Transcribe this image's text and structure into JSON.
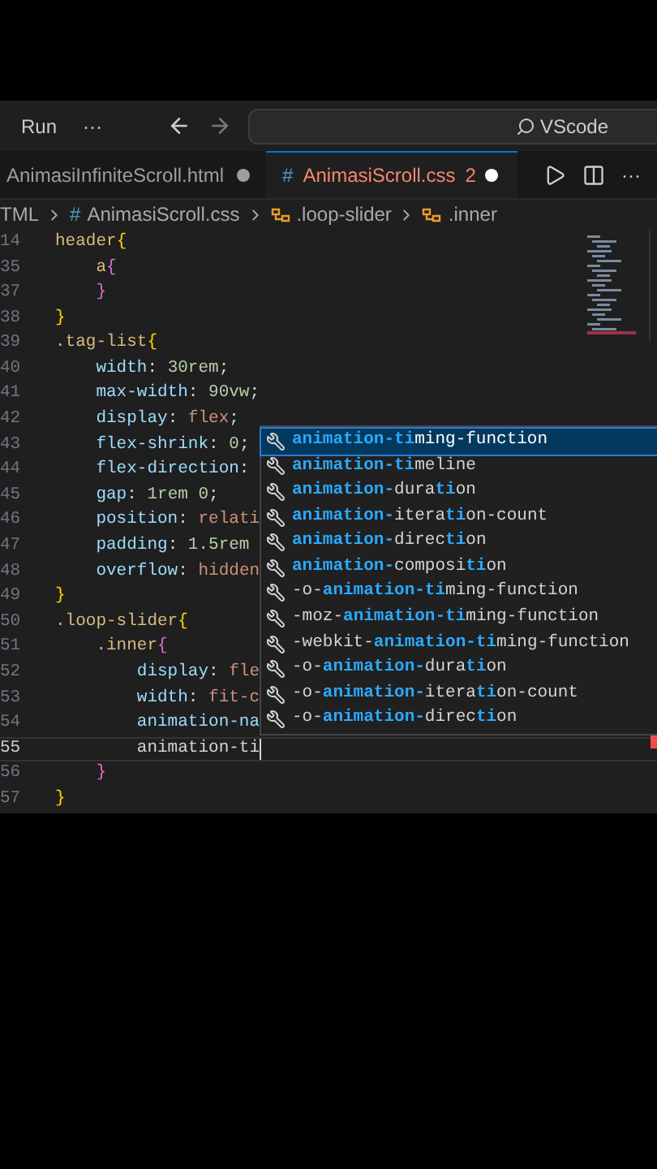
{
  "titlebar": {
    "run": "Run",
    "more": "···",
    "search": "VScode"
  },
  "tabs": [
    {
      "label": "AnimasiInfiniteScroll.html",
      "selected": false
    },
    {
      "label": "AnimasiScroll.css",
      "selected": true,
      "icon": "#",
      "problems": "2"
    }
  ],
  "editor_actions": {
    "more": "···"
  },
  "breadcrumb": [
    {
      "label": "TML",
      "kind": "text"
    },
    {
      "label": "AnimasiScroll.css",
      "kind": "css",
      "icon": "#"
    },
    {
      "label": ".loop-slider",
      "kind": "selector"
    },
    {
      "label": ".inner",
      "kind": "selector"
    }
  ],
  "lines": [
    {
      "number": "14",
      "current": false,
      "tokens": [
        {
          "kind": "selector",
          "text": "header"
        },
        {
          "kind": "brace1",
          "text": "{"
        }
      ]
    },
    {
      "number": "35",
      "current": false,
      "tokens": [
        {
          "kind": "selector",
          "text": "    a"
        },
        {
          "kind": "brace2",
          "text": "{"
        }
      ]
    },
    {
      "number": "37",
      "current": false,
      "tokens": [
        {
          "kind": "brace2",
          "text": "    }"
        }
      ]
    },
    {
      "number": "38",
      "current": false,
      "tokens": [
        {
          "kind": "brace1",
          "text": "}"
        }
      ]
    },
    {
      "number": "39",
      "current": false,
      "tokens": [
        {
          "kind": "selector",
          "text": ".tag-list"
        },
        {
          "kind": "brace1",
          "text": "{"
        }
      ]
    },
    {
      "number": "40",
      "current": false,
      "tokens": [
        {
          "kind": "property",
          "text": "    width"
        },
        {
          "kind": "plain",
          "text": ": "
        },
        {
          "kind": "number",
          "text": "30rem"
        },
        {
          "kind": "plain",
          "text": ";"
        }
      ]
    },
    {
      "number": "41",
      "current": false,
      "tokens": [
        {
          "kind": "property",
          "text": "    max-width"
        },
        {
          "kind": "plain",
          "text": ": "
        },
        {
          "kind": "number",
          "text": "90vw"
        },
        {
          "kind": "plain",
          "text": ";"
        }
      ]
    },
    {
      "number": "42",
      "current": false,
      "tokens": [
        {
          "kind": "property",
          "text": "    display"
        },
        {
          "kind": "plain",
          "text": ": "
        },
        {
          "kind": "value",
          "text": "flex"
        },
        {
          "kind": "plain",
          "text": ";"
        }
      ]
    },
    {
      "number": "43",
      "current": false,
      "tokens": [
        {
          "kind": "property",
          "text": "    flex-shrink"
        },
        {
          "kind": "plain",
          "text": ": "
        },
        {
          "kind": "number",
          "text": "0"
        },
        {
          "kind": "plain",
          "text": ";"
        }
      ]
    },
    {
      "number": "44",
      "current": false,
      "tokens": [
        {
          "kind": "property",
          "text": "    flex-direction"
        },
        {
          "kind": "plain",
          "text": ":"
        }
      ]
    },
    {
      "number": "45",
      "current": false,
      "tokens": [
        {
          "kind": "property",
          "text": "    gap"
        },
        {
          "kind": "plain",
          "text": ": "
        },
        {
          "kind": "number",
          "text": "1rem 0"
        },
        {
          "kind": "plain",
          "text": ";"
        }
      ]
    },
    {
      "number": "46",
      "current": false,
      "tokens": [
        {
          "kind": "property",
          "text": "    position"
        },
        {
          "kind": "plain",
          "text": ": "
        },
        {
          "kind": "value",
          "text": "relati"
        }
      ]
    },
    {
      "number": "47",
      "current": false,
      "tokens": [
        {
          "kind": "property",
          "text": "    padding"
        },
        {
          "kind": "plain",
          "text": ": "
        },
        {
          "kind": "number",
          "text": "1.5rem"
        }
      ]
    },
    {
      "number": "48",
      "current": false,
      "tokens": [
        {
          "kind": "property",
          "text": "    overflow"
        },
        {
          "kind": "plain",
          "text": ": "
        },
        {
          "kind": "value",
          "text": "hidden"
        }
      ]
    },
    {
      "number": "49",
      "current": false,
      "tokens": [
        {
          "kind": "brace1",
          "text": "}"
        }
      ]
    },
    {
      "number": "50",
      "current": false,
      "tokens": [
        {
          "kind": "selector",
          "text": ".loop-slider"
        },
        {
          "kind": "brace1",
          "text": "{"
        }
      ]
    },
    {
      "number": "51",
      "current": false,
      "tokens": [
        {
          "kind": "selector",
          "text": "    .inner"
        },
        {
          "kind": "brace2",
          "text": "{"
        }
      ]
    },
    {
      "number": "52",
      "current": false,
      "tokens": [
        {
          "kind": "property",
          "text": "        display"
        },
        {
          "kind": "plain",
          "text": ": "
        },
        {
          "kind": "value",
          "text": "fle"
        }
      ]
    },
    {
      "number": "53",
      "current": false,
      "tokens": [
        {
          "kind": "property",
          "text": "        width"
        },
        {
          "kind": "plain",
          "text": ": "
        },
        {
          "kind": "value",
          "text": "fit-c"
        }
      ]
    },
    {
      "number": "54",
      "current": false,
      "tokens": [
        {
          "kind": "property",
          "text": "        animation-na"
        }
      ]
    },
    {
      "number": "55",
      "current": true,
      "tokens": [
        {
          "kind": "plain",
          "text": "        animation-ti"
        }
      ]
    },
    {
      "number": "56",
      "current": false,
      "tokens": [
        {
          "kind": "brace2",
          "text": "    }"
        }
      ]
    },
    {
      "number": "57",
      "current": false,
      "tokens": [
        {
          "kind": "brace1",
          "text": "}"
        }
      ]
    }
  ],
  "suggestions": [
    {
      "selected": true,
      "parts": [
        {
          "text": "animation-ti",
          "match": true
        },
        {
          "text": "ming-function",
          "match": false
        }
      ]
    },
    {
      "selected": false,
      "parts": [
        {
          "text": "animation-ti",
          "match": true
        },
        {
          "text": "meline",
          "match": false
        }
      ]
    },
    {
      "selected": false,
      "parts": [
        {
          "text": "animation-",
          "match": true
        },
        {
          "text": "dura",
          "match": false
        },
        {
          "text": "ti",
          "match": true
        },
        {
          "text": "on",
          "match": false
        }
      ]
    },
    {
      "selected": false,
      "parts": [
        {
          "text": "animation-",
          "match": true
        },
        {
          "text": "itera",
          "match": false
        },
        {
          "text": "ti",
          "match": true
        },
        {
          "text": "on-count",
          "match": false
        }
      ]
    },
    {
      "selected": false,
      "parts": [
        {
          "text": "animation-",
          "match": true
        },
        {
          "text": "direc",
          "match": false
        },
        {
          "text": "ti",
          "match": true
        },
        {
          "text": "on",
          "match": false
        }
      ]
    },
    {
      "selected": false,
      "parts": [
        {
          "text": "animation-",
          "match": true
        },
        {
          "text": "composi",
          "match": false
        },
        {
          "text": "ti",
          "match": true
        },
        {
          "text": "on",
          "match": false
        }
      ]
    },
    {
      "selected": false,
      "parts": [
        {
          "text": "-o-",
          "match": false
        },
        {
          "text": "animation-ti",
          "match": true
        },
        {
          "text": "ming-function",
          "match": false
        }
      ]
    },
    {
      "selected": false,
      "parts": [
        {
          "text": "-moz-",
          "match": false
        },
        {
          "text": "animation-ti",
          "match": true
        },
        {
          "text": "ming-function",
          "match": false
        }
      ]
    },
    {
      "selected": false,
      "parts": [
        {
          "text": "-webkit-",
          "match": false
        },
        {
          "text": "animation-ti",
          "match": true
        },
        {
          "text": "ming-function",
          "match": false
        }
      ]
    },
    {
      "selected": false,
      "parts": [
        {
          "text": "-o-",
          "match": false
        },
        {
          "text": "animation-",
          "match": true
        },
        {
          "text": "dura",
          "match": false
        },
        {
          "text": "ti",
          "match": true
        },
        {
          "text": "on",
          "match": false
        }
      ]
    },
    {
      "selected": false,
      "parts": [
        {
          "text": "-o-",
          "match": false
        },
        {
          "text": "animation-",
          "match": true
        },
        {
          "text": "itera",
          "match": false
        },
        {
          "text": "ti",
          "match": true
        },
        {
          "text": "on-count",
          "match": false
        }
      ]
    },
    {
      "selected": false,
      "parts": [
        {
          "text": "-o-",
          "match": false
        },
        {
          "text": "animation-",
          "match": true
        },
        {
          "text": "direc",
          "match": false
        },
        {
          "text": "ti",
          "match": true
        },
        {
          "text": "on",
          "match": false
        }
      ]
    }
  ]
}
